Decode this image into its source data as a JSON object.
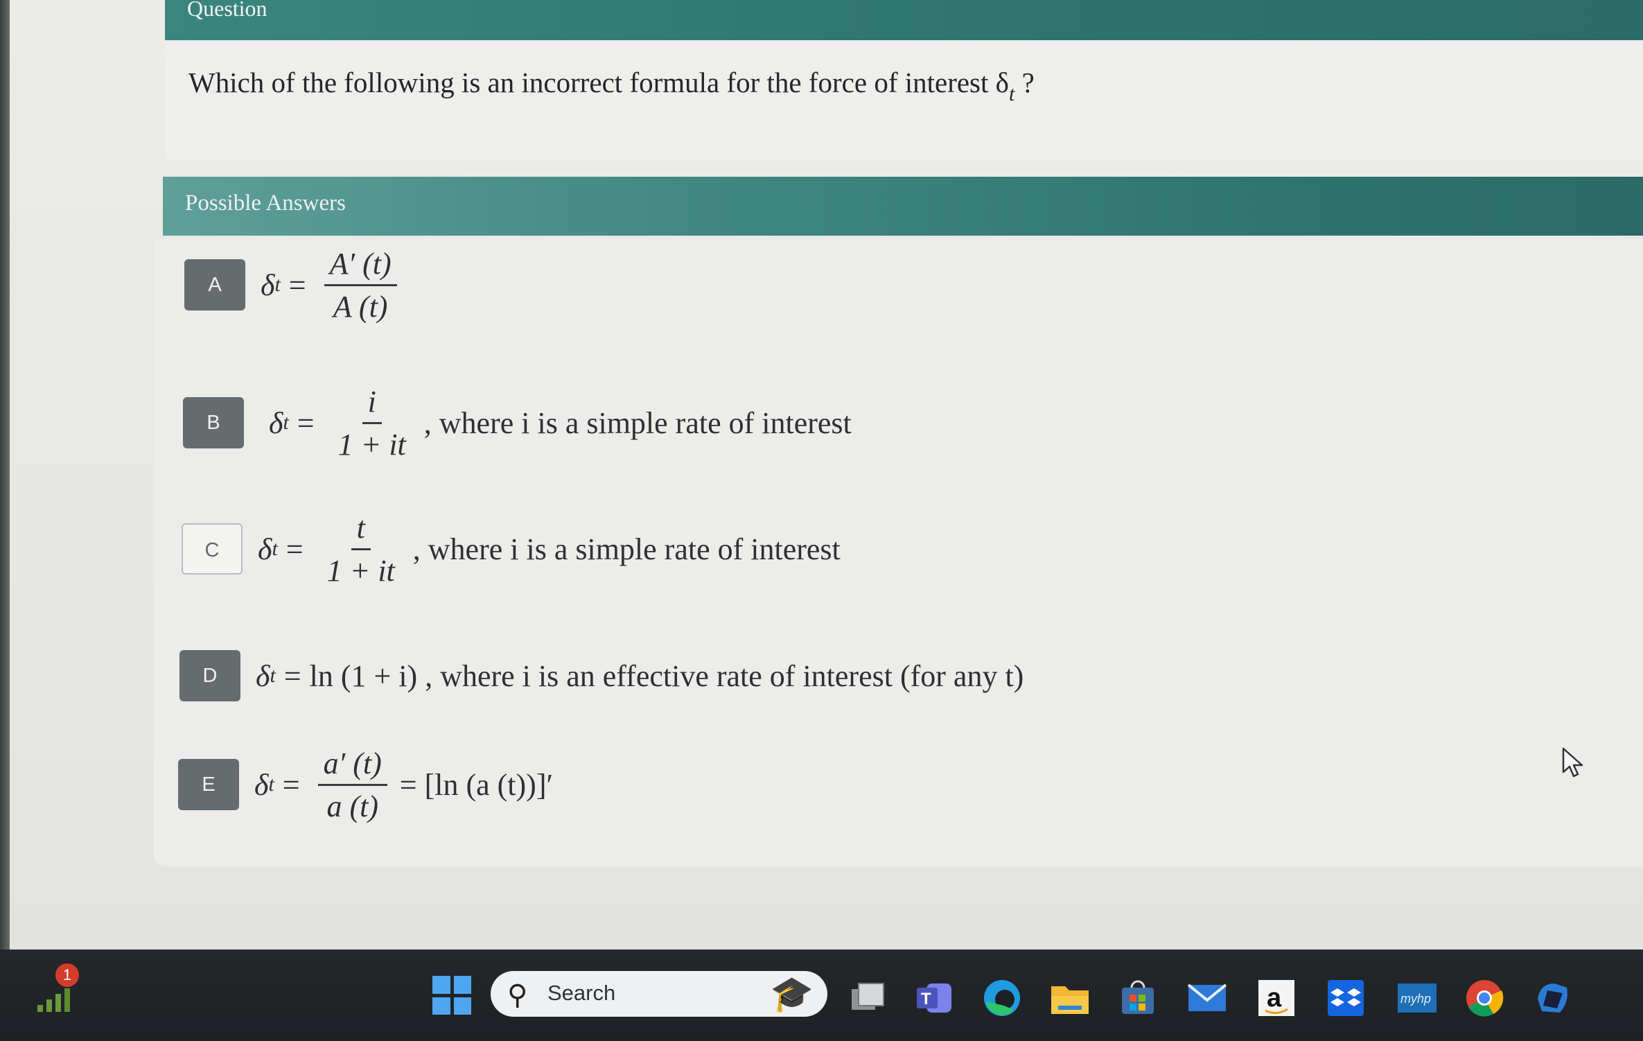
{
  "question": {
    "header": "Question",
    "text": "Which of the following is an incorrect formula for the force of interest δ",
    "text_sub": "t",
    "text_end": " ?"
  },
  "answers": {
    "header": "Possible Answers",
    "items": [
      {
        "letter": "A",
        "lhs": "δ",
        "sub": "t",
        "rel": "=",
        "num": "A′ (t)",
        "den": "A (t)",
        "suffix": "",
        "selected": false
      },
      {
        "letter": "B",
        "lhs": "δ",
        "sub": "t",
        "rel": "=",
        "num": "i",
        "den": "1 + it",
        "suffix": " , where i is a simple rate of interest",
        "selected": false
      },
      {
        "letter": "C",
        "lhs": "δ",
        "sub": "t",
        "rel": "=",
        "num": "t",
        "den": "1 + it",
        "suffix": " , where i is a simple rate of interest",
        "selected": true
      },
      {
        "letter": "D",
        "lhs": "δ",
        "sub": "t",
        "rel": "=",
        "expr": "ln (1 + i) , where i is an effective rate of interest (for any t)",
        "selected": false
      },
      {
        "letter": "E",
        "lhs": "δ",
        "sub": "t",
        "rel": "=",
        "num": "a′ (t)",
        "den": "a (t)",
        "suffix": "= [ln (a (t))]′",
        "selected": false
      }
    ]
  },
  "taskbar": {
    "notification_count": "1",
    "search_placeholder": "Search",
    "icons": [
      "windows-start-icon",
      "task-view-icon",
      "teams-icon",
      "edge-icon",
      "file-explorer-icon",
      "store-icon",
      "mail-icon",
      "amazon-icon",
      "dropbox-icon",
      "myhp-icon",
      "chrome-icon",
      "copilot-icon"
    ],
    "amazon_label": "a",
    "myhp_label": "myhp"
  }
}
